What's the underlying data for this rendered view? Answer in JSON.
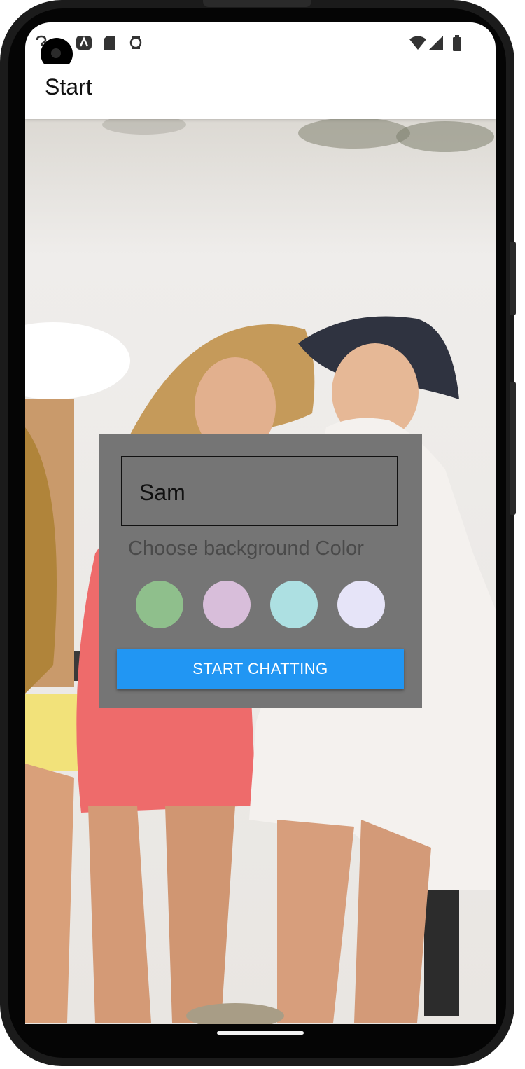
{
  "status_bar": {
    "icons": [
      "question-icon",
      "android-studio-icon",
      "sd-card-icon",
      "accessibility-icon",
      "wifi-icon",
      "cellular-signal-icon",
      "battery-icon"
    ]
  },
  "app_bar": {
    "title": "Start"
  },
  "form": {
    "name_value": "Sam",
    "color_label": "Choose background Color",
    "colors": [
      "#8FBF8C",
      "#D8BEDA",
      "#ADE0E2",
      "#E6E4F8"
    ],
    "start_button": "START CHATTING",
    "button_color": "#2196F3",
    "card_color": "#757575"
  }
}
